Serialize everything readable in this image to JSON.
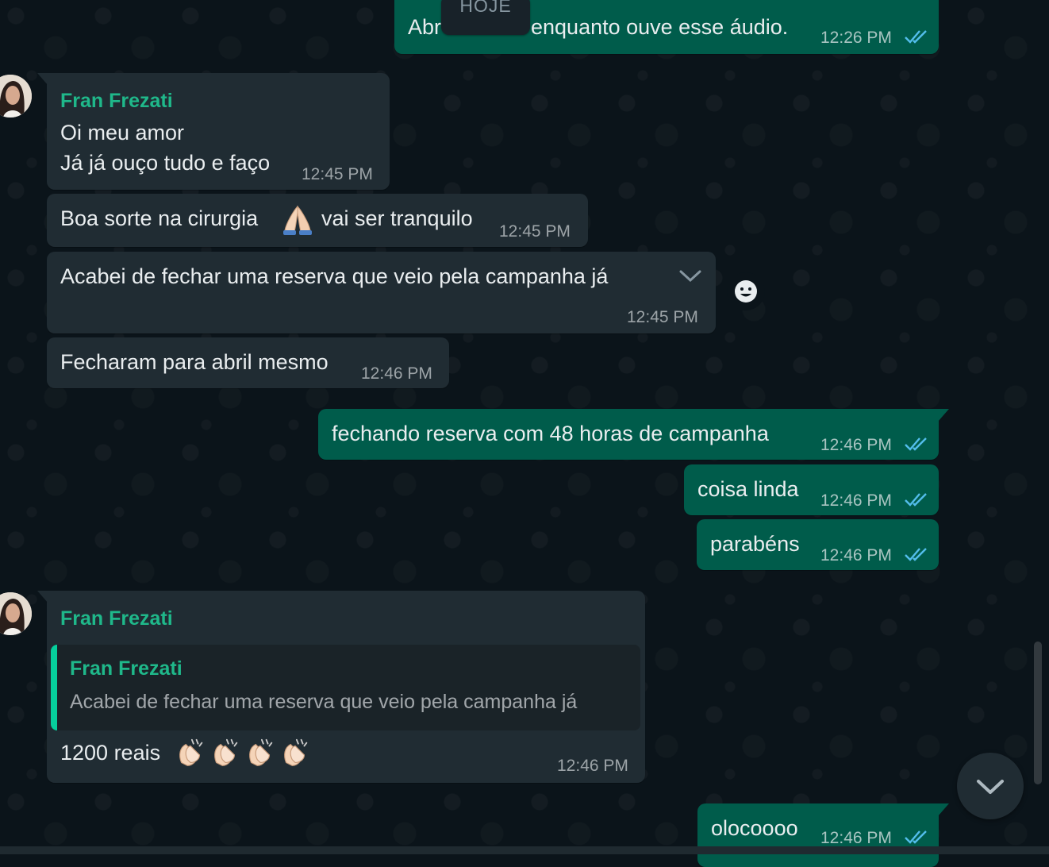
{
  "date_divider": "HOJE",
  "contact": {
    "name": "Fran Frezati"
  },
  "messages": [
    {
      "id": "m1",
      "direction": "out",
      "text": "Abra enquanto ouve esse áudio.",
      "visible_left": "Abr",
      "visible_right": "enquanto ouve esse áudio.",
      "time": "12:26 PM",
      "status": "read"
    },
    {
      "id": "m2",
      "direction": "in",
      "sender": "Fran Frezati",
      "lines": [
        "Oi meu amor",
        "Já já ouço tudo e faço"
      ],
      "time": "12:45 PM"
    },
    {
      "id": "m3",
      "direction": "in",
      "text_before": "Boa sorte na cirurgia",
      "emoji": "folded-hands",
      "text_after": "vai ser tranquilo",
      "time": "12:45 PM"
    },
    {
      "id": "m4",
      "direction": "in",
      "text": "Acabei de fechar uma reserva que veio pela campanha já",
      "time": "12:45 PM"
    },
    {
      "id": "m5",
      "direction": "in",
      "text": "Fecharam para abril mesmo",
      "time": "12:46 PM"
    },
    {
      "id": "m6",
      "direction": "out",
      "text": "fechando reserva com 48 horas de campanha",
      "time": "12:46 PM",
      "status": "read"
    },
    {
      "id": "m7",
      "direction": "out",
      "text": "coisa linda",
      "time": "12:46 PM",
      "status": "read"
    },
    {
      "id": "m8",
      "direction": "out",
      "text": "parabéns",
      "time": "12:46 PM",
      "status": "read"
    },
    {
      "id": "m9",
      "direction": "in",
      "sender": "Fran Frezati",
      "quote": {
        "sender": "Fran Frezati",
        "text": "Acabei de fechar uma reserva que veio pela campanha já"
      },
      "text": "1200 reais",
      "emoji": "clapping-hands",
      "emoji_count": 4,
      "time": "12:46 PM"
    },
    {
      "id": "m10",
      "direction": "out",
      "text": "olocoooo",
      "time": "12:46 PM",
      "status": "read"
    }
  ],
  "colors": {
    "background": "#0b141a",
    "incoming_bubble": "#202c33",
    "outgoing_bubble": "#005c4b",
    "sender_name": "#1fb88a",
    "read_check": "#53bdeb",
    "quote_bar": "#06cf9c"
  },
  "icons": {
    "message_menu": "chevron-down-icon",
    "reaction": "emoji-smile-icon",
    "scroll_to_bottom": "chevron-down-icon",
    "read_receipt": "double-check-icon"
  }
}
